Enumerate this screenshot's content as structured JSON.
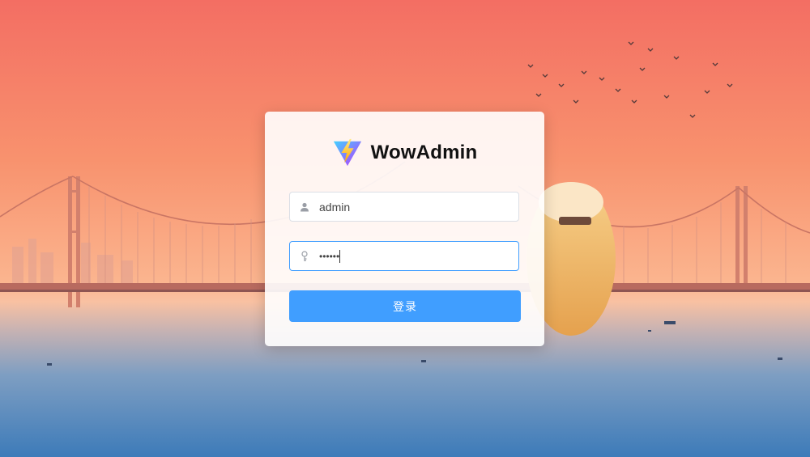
{
  "app": {
    "title": "WowAdmin",
    "logo_icon": "vite-logo-icon"
  },
  "form": {
    "username": {
      "value": "admin",
      "icon": "user-icon"
    },
    "password": {
      "value": "••••••",
      "icon": "key-icon"
    },
    "submit_label": "登录"
  },
  "colors": {
    "primary": "#409eff",
    "sky_top": "#f57062",
    "sky_bottom": "#fcb894",
    "water": "#4a86c0"
  }
}
